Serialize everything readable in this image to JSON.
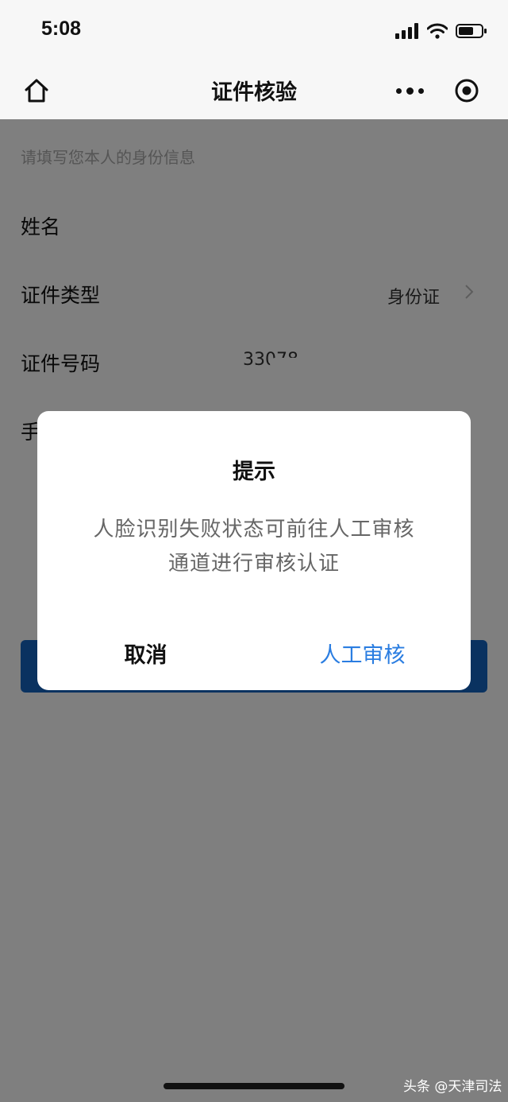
{
  "status_bar": {
    "time": "5:08"
  },
  "nav": {
    "title": "证件核验"
  },
  "form": {
    "hint": "请填写您本人的身份信息",
    "rows": [
      {
        "label": "姓名",
        "value": ""
      },
      {
        "label": "证件类型",
        "value": "身份证"
      },
      {
        "label": "证件号码",
        "value": "33078"
      },
      {
        "label": "手"
      }
    ]
  },
  "dialog": {
    "title": "提示",
    "message_line1": "人脸识别失败状态可前往人工审核",
    "message_line2": "通道进行审核认证",
    "cancel_label": "取消",
    "confirm_label": "人工审核"
  },
  "watermark": "头条 @天津司法",
  "colors": {
    "accent": "#2a7de1",
    "button": "#1565c0",
    "mask": "rgba(0,0,0,0.5)"
  }
}
